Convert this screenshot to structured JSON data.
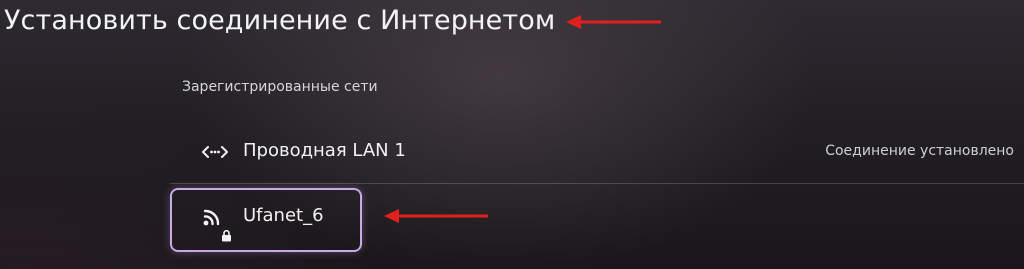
{
  "page": {
    "title": "Установить соединение с Интернетом"
  },
  "registered_networks": {
    "label": "Зарегистрированные сети",
    "items": [
      {
        "name": "Проводная LAN 1",
        "icon": "wired-lan-icon",
        "status": "Соединение установлено"
      },
      {
        "name": "Ufanet_6",
        "icon": "wifi-icon",
        "secured": true,
        "status": ""
      }
    ]
  },
  "annotations": {
    "arrow_color": "#e0201f"
  },
  "colors": {
    "focus_outline": "#c9a9e6",
    "background": "#231f25"
  }
}
